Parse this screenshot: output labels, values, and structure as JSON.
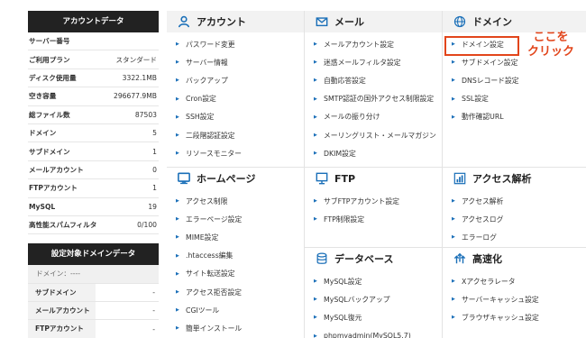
{
  "account_data": {
    "title": "アカウントデータ",
    "rows": [
      {
        "label": "サーバー番号",
        "value": ""
      },
      {
        "label": "ご利用プラン",
        "value": "スタンダード"
      },
      {
        "label": "ディスク使用量",
        "value": "3322.1MB"
      },
      {
        "label": "空き容量",
        "value": "296677.9MB"
      },
      {
        "label": "総ファイル数",
        "value": "87503"
      },
      {
        "label": "ドメイン",
        "value": "5"
      },
      {
        "label": "サブドメイン",
        "value": "1"
      },
      {
        "label": "メールアカウント",
        "value": "0"
      },
      {
        "label": "FTPアカウント",
        "value": "1"
      },
      {
        "label": "MySQL",
        "value": "19"
      },
      {
        "label": "高性能スパムフィルタ",
        "value": "0/100"
      }
    ]
  },
  "domain_data": {
    "title": "設定対象ドメインデータ",
    "domain_row": "ドメイン：----",
    "rows": [
      {
        "label": "サブドメイン",
        "value": "-"
      },
      {
        "label": "メールアカウント",
        "value": "-"
      },
      {
        "label": "FTPアカウント",
        "value": "-"
      }
    ]
  },
  "sections": {
    "account": {
      "title": "アカウント",
      "items": [
        "パスワード変更",
        "サーバー情報",
        "バックアップ",
        "Cron設定",
        "SSH設定",
        "二段階認証設定",
        "リソースモニター"
      ]
    },
    "mail": {
      "title": "メール",
      "items": [
        "メールアカウント設定",
        "迷惑メールフィルタ設定",
        "自動応答設定",
        "SMTP認証の国外アクセス制限設定",
        "メールの振り分け",
        "メーリングリスト・メールマガジン",
        "DKIM設定"
      ]
    },
    "domain": {
      "title": "ドメイン",
      "items": [
        "ドメイン設定",
        "サブドメイン設定",
        "DNSレコード設定",
        "SSL設定",
        "動作確認URL"
      ]
    },
    "homepage": {
      "title": "ホームページ",
      "items": [
        "アクセス制限",
        "エラーページ設定",
        "MIME設定",
        ".htaccess編集",
        "サイト転送設定",
        "アクセス拒否設定",
        "CGIツール",
        "簡単インストール"
      ]
    },
    "ftp": {
      "title": "FTP",
      "items": [
        "サブFTPアカウント設定",
        "FTP制限設定"
      ]
    },
    "access": {
      "title": "アクセス解析",
      "items": [
        "アクセス解析",
        "アクセスログ",
        "エラーログ"
      ]
    },
    "database": {
      "title": "データベース",
      "items": [
        "MySQL設定",
        "MySQLバックアップ",
        "MySQL復元",
        "phpmyadmin(MySQL5.7)"
      ]
    },
    "speed": {
      "title": "高速化",
      "items": [
        "Xアクセラレータ",
        "サーバーキャッシュ設定",
        "ブラウザキャッシュ設定"
      ]
    }
  },
  "annotation": {
    "line1": "ここを",
    "line2": "クリック",
    "color": "#e2451b"
  },
  "colors": {
    "arrow": "#1a6fb8",
    "header_bg": "#222222"
  }
}
